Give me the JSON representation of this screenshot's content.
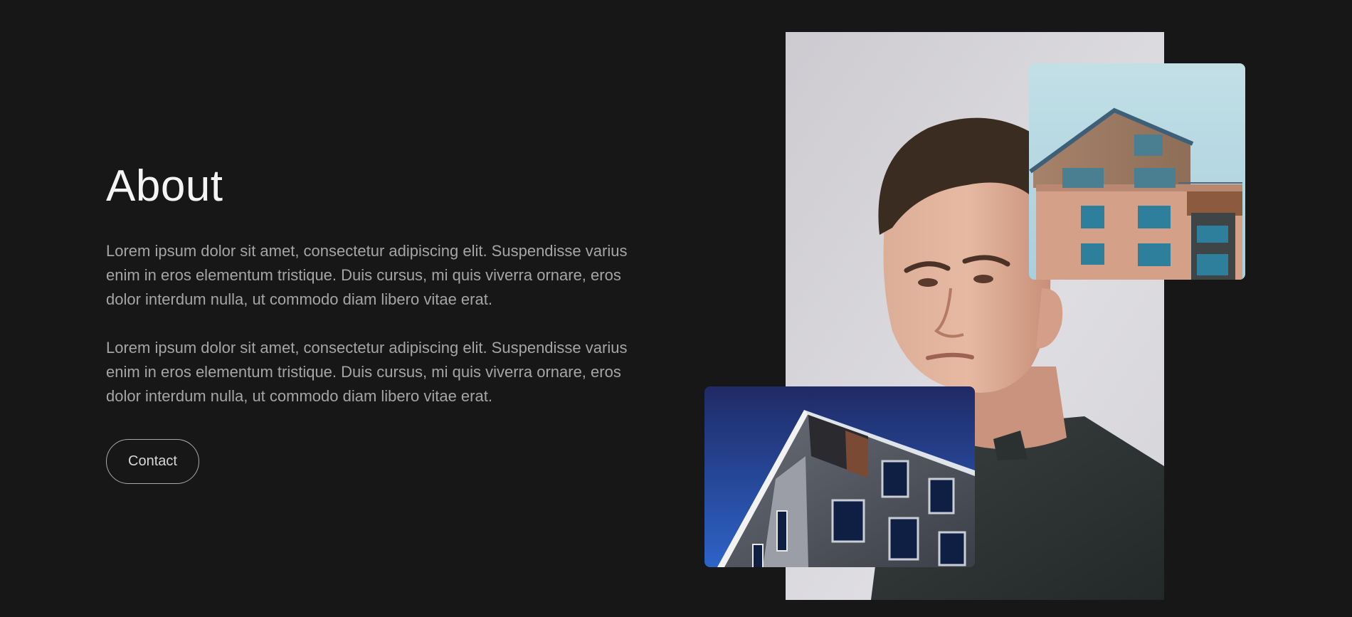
{
  "about": {
    "title": "About",
    "paragraphs": [
      "Lorem ipsum dolor sit amet, consectetur adipiscing elit. Suspendisse varius enim in eros elementum tristique. Duis cursus, mi quis viverra ornare, eros dolor interdum nulla, ut commodo diam libero vitae erat.",
      "Lorem ipsum dolor sit amet, consectetur adipiscing elit. Suspendisse varius enim in eros elementum tristique. Duis cursus, mi quis viverra ornare, eros dolor interdum nulla, ut commodo diam libero vitae erat."
    ],
    "contact_label": "Contact"
  },
  "colors": {
    "background": "#171717",
    "heading": "#f4f4f4",
    "body_text": "#a5a5a5",
    "button_border": "#a9a9a9"
  }
}
